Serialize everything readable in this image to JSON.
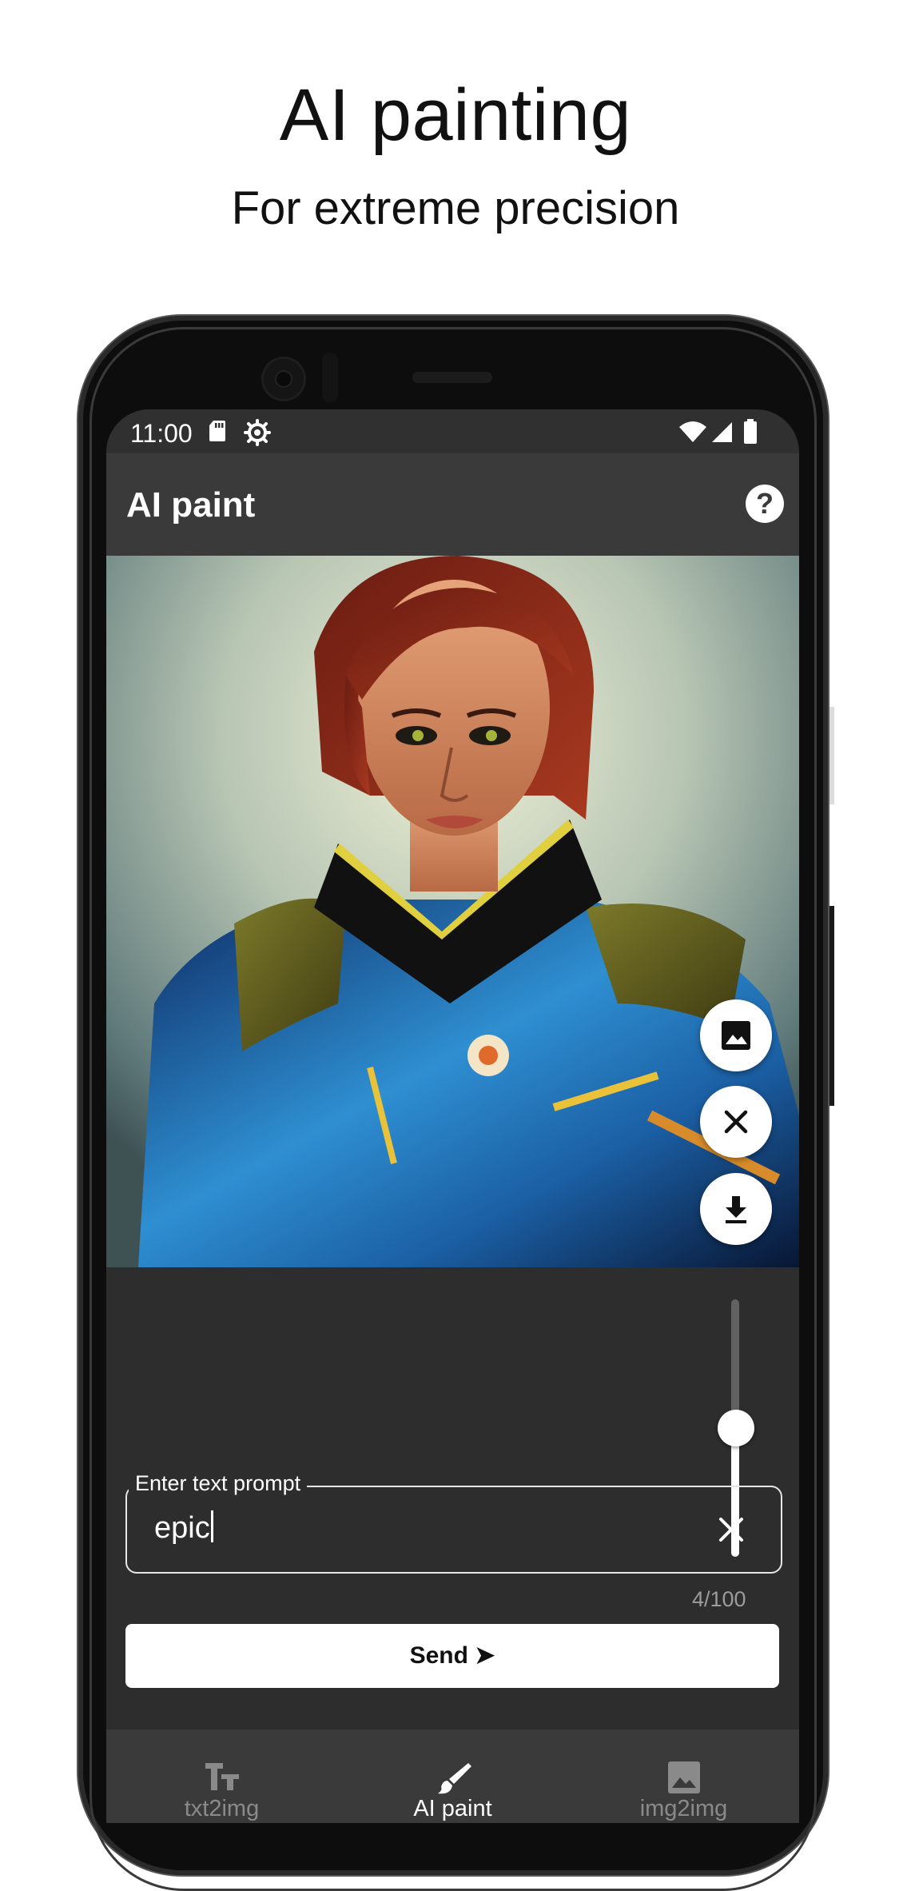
{
  "promo": {
    "headline": "AI painting",
    "subheadline": "For extreme precision"
  },
  "statusbar": {
    "time": "11:00",
    "icons": [
      "sd-card-icon",
      "settings-gear-icon",
      "wifi-icon",
      "signal-icon",
      "battery-icon"
    ]
  },
  "appbar": {
    "title": "AI paint",
    "help_icon": "question-mark"
  },
  "canvas": {
    "image": "generated portrait of a red-haired woman in a blue and gold armored jacket",
    "tools": [
      "image-icon",
      "close-icon",
      "download-icon"
    ],
    "brush_size_level": 0.5,
    "brush_color": "#ff0000"
  },
  "prompt": {
    "label": "Enter text prompt",
    "value": "epic",
    "counter": "4/100"
  },
  "send_button": {
    "label": "Send ➤"
  },
  "bottom_nav": {
    "items": [
      {
        "label": "txt2img",
        "icon": "text-icon",
        "active": false
      },
      {
        "label": "AI paint",
        "icon": "brush-icon",
        "active": true
      },
      {
        "label": "img2img",
        "icon": "image-icon",
        "active": false
      }
    ]
  },
  "colors": {
    "screen_bg": "#2d2d2d",
    "appbar_bg": "#3a3a3a",
    "brush_red": "#ff0000",
    "inactive_nav": "#8a8a8a"
  }
}
